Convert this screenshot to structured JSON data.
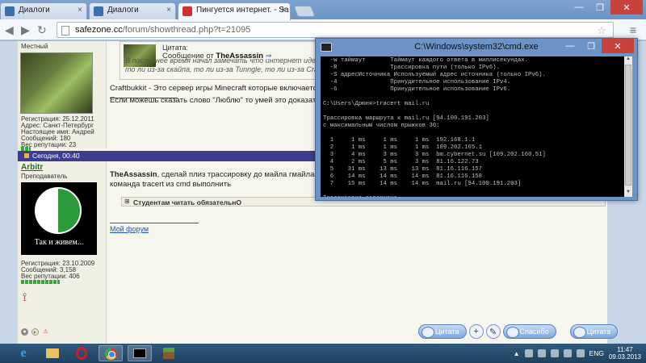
{
  "browser": {
    "tabs": [
      {
        "label": "Диалоги"
      },
      {
        "label": "Диалоги"
      },
      {
        "label": "Пингуется интернет. - Sa"
      }
    ],
    "url_host": "safezone.cc",
    "url_path": "/forum/showthread.php?t=21095"
  },
  "post1": {
    "status": "Местный",
    "registration": "Регистрация: 25.12.2011",
    "address": "Адрес: Санкт-Петербург",
    "real_name": "Настоящее имя: Андрей",
    "messages": "Сообщений: 180",
    "reputation": "Вес репутации: 23",
    "quote_label": "Цитата:",
    "quote_prefix": "Сообщение от",
    "quote_author": "TheAssassin",
    "quote_line1": "В последнее время начал замечать что интернет идет с п",
    "quote_line2": "то ли из-за скайпа, то ли из-за Tunngle, то ли из-за Craft",
    "text1": "Craftbukkit - Это сервер игры Minecraft которые включается от",
    "text2": "Если можешь сказать слово \"Люблю\" то умей это доказать, а н"
  },
  "post2": {
    "date": "Сегодня, 00:40",
    "author": "Arbitr",
    "role": "Преподаватель",
    "avatar_caption": "Так и живем...",
    "registration": "Регистрация: 23.10.2009",
    "messages": "Сообщений: 3,158",
    "reputation": "Вес репутации: 406",
    "text_author": "TheAssassin",
    "text_line1": ", сделай плиз трассировку до майла гмайла яндек",
    "text_line2": "команда tracert из cmd выполнить",
    "spoiler": "Студентам читать обязательнО",
    "my_forum": "Мой форум"
  },
  "buttons": {
    "quote": "Цитата",
    "thanks": "Спасибо",
    "quote2": "Цитата"
  },
  "cmd": {
    "title": "C:\\Windows\\system32\\cmd.exe",
    "output": "  -w таймаут       Таймаут каждого ответа в миллисекундах.\n  -R               Трассировка пути (только IPv6).\n  -S адресИсточника Используемый адрес источника (только IPv6).\n  -4               Принудительное использование IPv4.\n  -6               Принудительное использование IPv6.\n\nC:\\Users\\Дрюня>tracert mail.ru\n\nТрассировка маршрута к mail.ru [94.100.191.203]\nс максимальным числом прыжков 30:\n\n  1     1 ms     1 ms     1 ms  192.168.1.1\n  2     1 ms     1 ms     1 ms  109.202.165.1\n  3     4 ms     3 ms     3 ms  bm.cybernet.su [109.202.160.51]\n  4     2 ms     5 ms     3 ms  81.16.122.73\n  5    31 ms    13 ms    13 ms  81.16.116.157\n  6    14 ms    14 ms    14 ms  81.16.116.158\n  7    15 ms    14 ms    14 ms  mail.ru [94.100.191.203]\n\nТрассировка завершена.\n\nC:\\Users\\Дрюня>_"
  },
  "taskbar": {
    "lang": "ENG",
    "time": "11:47",
    "date": "09.03.2013"
  }
}
